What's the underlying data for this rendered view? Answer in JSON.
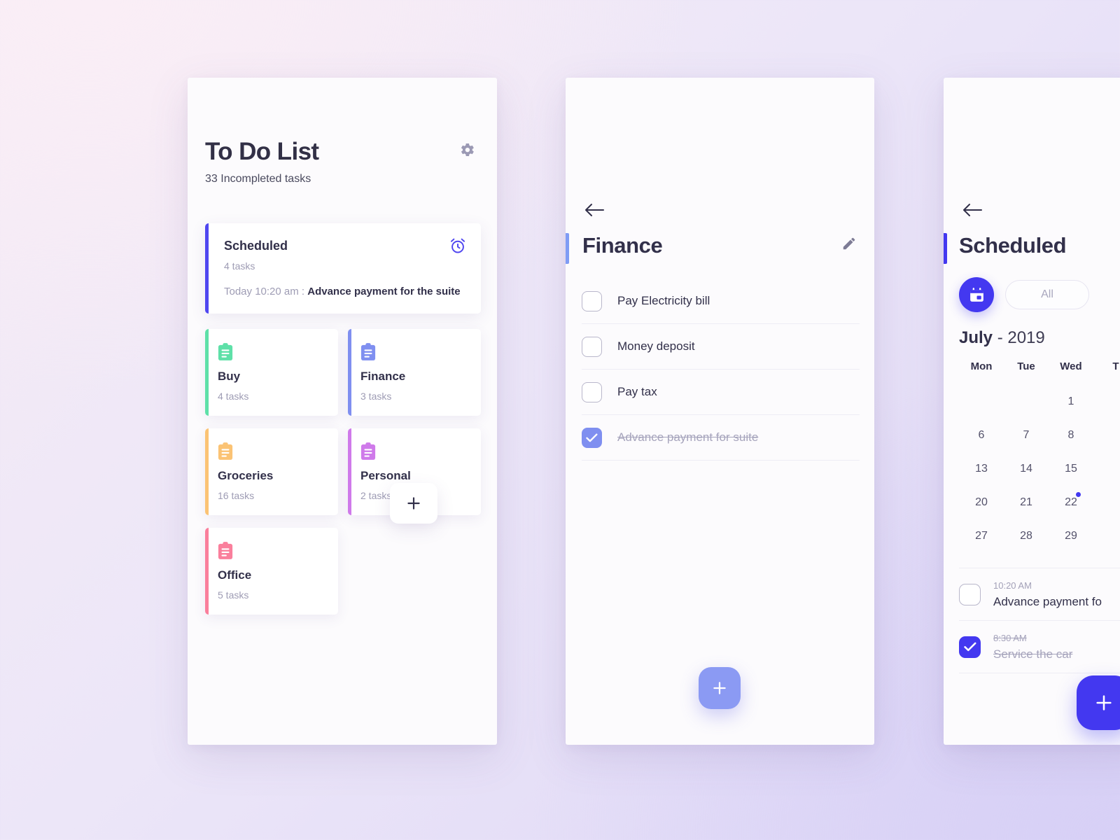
{
  "theme": {
    "accent_indigo": "#4338f0",
    "accent_periwinkle": "#7f8ff0",
    "text_dark": "#32304a",
    "text_muted": "#9e9cb4"
  },
  "panel1": {
    "title": "To Do List",
    "subtitle": "33 Incompleted tasks",
    "gear_icon": "gear-icon",
    "scheduled_card": {
      "title": "Scheduled",
      "count": "4 tasks",
      "time": "Today 10:20 am : ",
      "task": "Advance payment for the suite",
      "icon": "alarm-clock-icon"
    },
    "categories": [
      {
        "name": "Buy",
        "count": "4 tasks",
        "color": "#5ee0a8",
        "icon": "clipboard-icon"
      },
      {
        "name": "Finance",
        "count": "3 tasks",
        "color": "#7f8ff0",
        "icon": "clipboard-icon"
      },
      {
        "name": "Groceries",
        "count": "16 tasks",
        "color": "#fbc374",
        "icon": "clipboard-icon"
      },
      {
        "name": "Personal",
        "count": "2 tasks",
        "color": "#cf7aea",
        "icon": "clipboard-icon"
      },
      {
        "name": "Office",
        "count": "5 tasks",
        "color": "#fa7f9c",
        "icon": "clipboard-icon"
      }
    ],
    "add_label": "+"
  },
  "panel2": {
    "back_icon": "back-arrow-icon",
    "title": "Finance",
    "edit_icon": "pencil-icon",
    "accent_color": "#7f9cf5",
    "tasks": [
      {
        "label": "Pay Electricity bill",
        "done": false
      },
      {
        "label": "Money deposit",
        "done": false
      },
      {
        "label": "Pay tax",
        "done": false
      },
      {
        "label": "Advance payment for suite",
        "done": true
      }
    ],
    "fab_label": "+"
  },
  "panel3": {
    "back_icon": "back-arrow-icon",
    "title": "Scheduled",
    "accent_color": "#4338f0",
    "calendar_toggle_icon": "calendar-icon",
    "all_label": "All",
    "month": "July",
    "year": "- 2019",
    "weekday_headers": [
      "Mon",
      "Tue",
      "Wed",
      "T"
    ],
    "weeks": [
      [
        "",
        "",
        "1",
        ""
      ],
      [
        "6",
        "7",
        "8",
        ""
      ],
      [
        "13",
        "14",
        "15",
        ""
      ],
      [
        "20",
        "21",
        "22",
        ""
      ],
      [
        "27",
        "28",
        "29",
        ""
      ]
    ],
    "marked_day": "22",
    "events": [
      {
        "time": "10:20 AM",
        "name": "Advance payment fo",
        "done": false
      },
      {
        "time": "8:30 AM",
        "name": "Service the car",
        "done": true
      }
    ],
    "fab_label": "+"
  }
}
